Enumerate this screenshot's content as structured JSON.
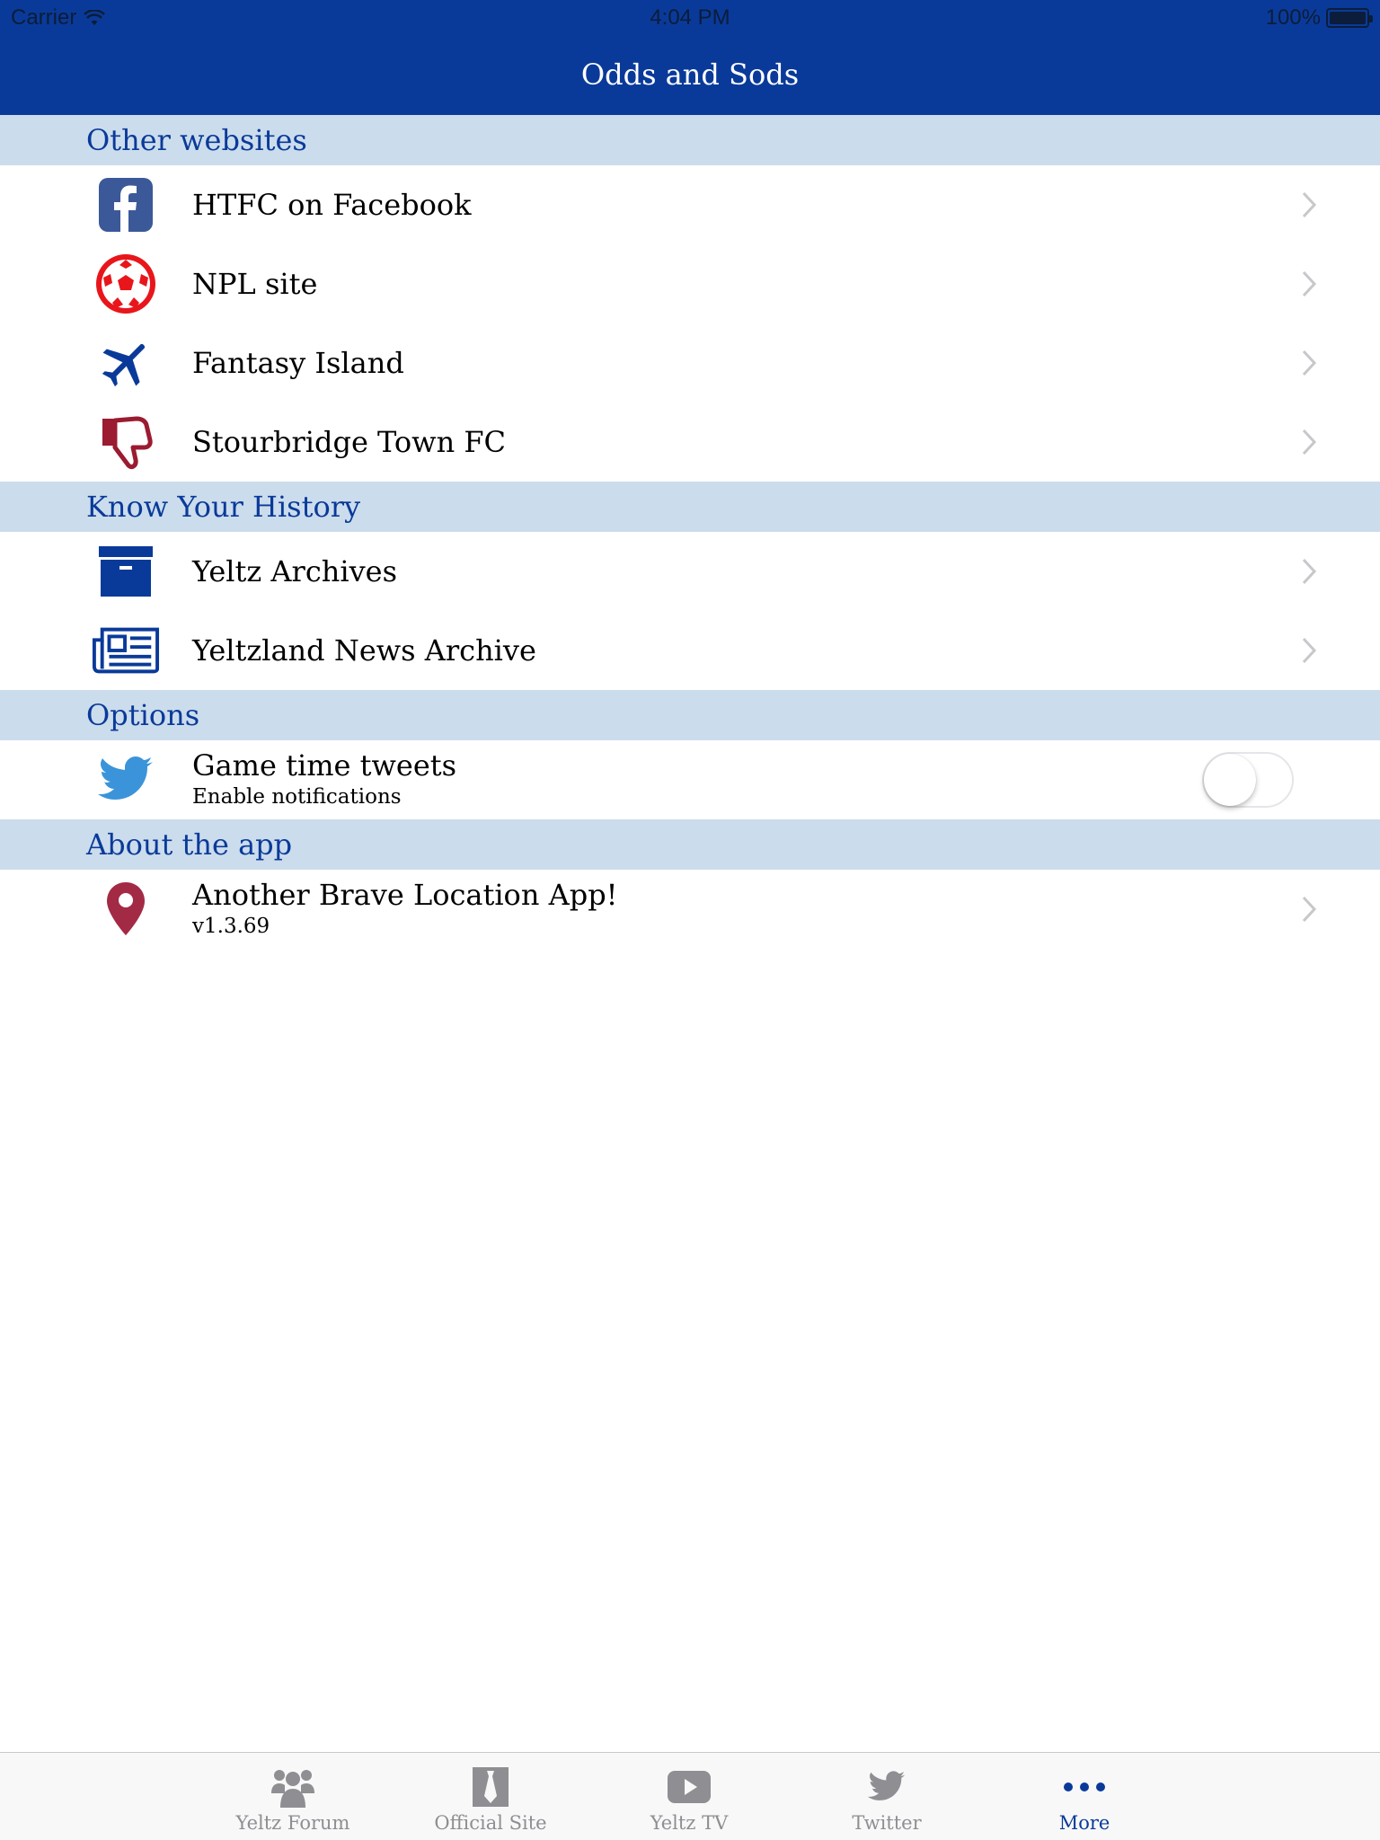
{
  "status_bar": {
    "carrier": "Carrier",
    "time": "4:04 PM",
    "battery": "100%"
  },
  "nav": {
    "title": "Odds and Sods"
  },
  "colors": {
    "brand_blue": "#0a3a99",
    "section_bg": "#cbdcec",
    "red": "#9b1b30"
  },
  "sections": [
    {
      "title": "Other websites",
      "items": [
        {
          "label": "HTFC on Facebook",
          "icon": "facebook-icon"
        },
        {
          "label": "NPL site",
          "icon": "football-icon"
        },
        {
          "label": "Fantasy Island",
          "icon": "airplane-icon"
        },
        {
          "label": "Stourbridge Town FC",
          "icon": "thumbs-down-icon"
        }
      ]
    },
    {
      "title": "Know Your History",
      "items": [
        {
          "label": "Yeltz Archives",
          "icon": "archive-box-icon"
        },
        {
          "label": "Yeltzland News Archive",
          "icon": "newspaper-icon"
        }
      ]
    },
    {
      "title": "Options",
      "items": [
        {
          "label": "Game time tweets",
          "sublabel": "Enable notifications",
          "icon": "twitter-bird-icon",
          "toggle": false
        }
      ]
    },
    {
      "title": "About the app",
      "items": [
        {
          "label": "Another Brave Location App!",
          "sublabel": "v1.3.69",
          "icon": "location-pin-icon"
        }
      ]
    }
  ],
  "tabbar": {
    "tabs": [
      {
        "label": "Yeltz Forum",
        "icon": "group-icon",
        "active": false
      },
      {
        "label": "Official Site",
        "icon": "tie-icon",
        "active": false
      },
      {
        "label": "Yeltz TV",
        "icon": "video-play-icon",
        "active": false
      },
      {
        "label": "Twitter",
        "icon": "twitter-bird-icon",
        "active": false
      },
      {
        "label": "More",
        "icon": "more-dots-icon",
        "active": true
      }
    ]
  }
}
